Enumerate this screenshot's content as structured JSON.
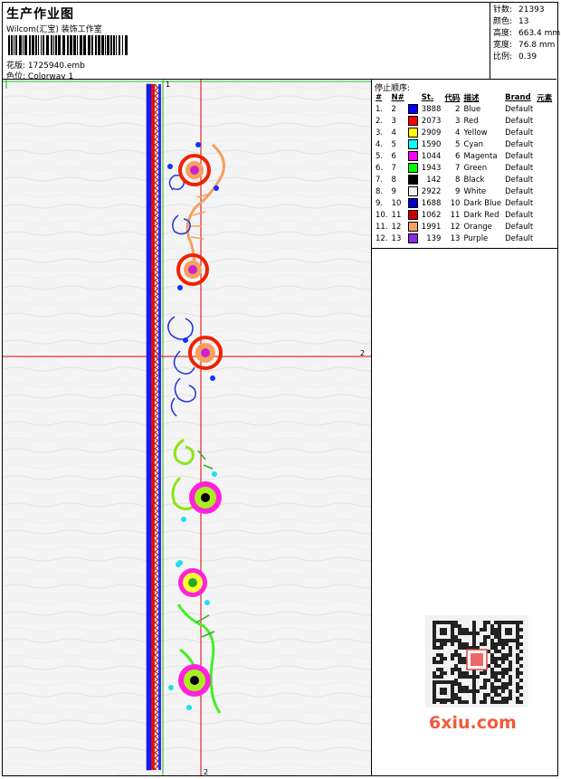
{
  "header": {
    "title": "生产作业图",
    "company": "Wilcom(汇宝) 装饰工作室",
    "design_label": "花版:",
    "design_file": "1725940.emb",
    "colorway_label": "色位:",
    "colorway": "Colorway 1"
  },
  "stats": [
    {
      "label": "针数:",
      "value": "21393"
    },
    {
      "label": "颜色:",
      "value": "13"
    },
    {
      "label": "高度:",
      "value": "663.4 mm"
    },
    {
      "label": "宽度:",
      "value": "76.8 mm"
    },
    {
      "label": "比例:",
      "value": "0.39"
    }
  ],
  "guides": {
    "v1": "1",
    "h2": "2",
    "v2": "2"
  },
  "stop_sequence": {
    "title": "停止顺序:",
    "headers": [
      "#",
      "N#",
      "St.",
      "代码",
      "描述",
      "Brand",
      "元素"
    ],
    "rows": [
      {
        "idx": "1.",
        "n": "2",
        "color": "#0000ff",
        "st": "3888",
        "code": "2",
        "desc": "Blue",
        "brand": "Default"
      },
      {
        "idx": "2.",
        "n": "3",
        "color": "#ff0000",
        "st": "2073",
        "code": "3",
        "desc": "Red",
        "brand": "Default"
      },
      {
        "idx": "3.",
        "n": "4",
        "color": "#ffff00",
        "st": "2909",
        "code": "4",
        "desc": "Yellow",
        "brand": "Default"
      },
      {
        "idx": "4.",
        "n": "5",
        "color": "#00ffff",
        "st": "1590",
        "code": "5",
        "desc": "Cyan",
        "brand": "Default"
      },
      {
        "idx": "5.",
        "n": "6",
        "color": "#ff00ff",
        "st": "1044",
        "code": "6",
        "desc": "Magenta",
        "brand": "Default"
      },
      {
        "idx": "6.",
        "n": "7",
        "color": "#00ff00",
        "st": "1943",
        "code": "7",
        "desc": "Green",
        "brand": "Default"
      },
      {
        "idx": "7.",
        "n": "8",
        "color": "#000000",
        "st": "142",
        "code": "8",
        "desc": "Black",
        "brand": "Default"
      },
      {
        "idx": "8.",
        "n": "9",
        "color": "#f0f0f0",
        "st": "2922",
        "code": "9",
        "desc": "White",
        "brand": "Default"
      },
      {
        "idx": "9.",
        "n": "10",
        "color": "#0000c8",
        "st": "1688",
        "code": "10",
        "desc": "Dark Blue",
        "brand": "Default"
      },
      {
        "idx": "10.",
        "n": "11",
        "color": "#cc0000",
        "st": "1062",
        "code": "11",
        "desc": "Dark Red",
        "brand": "Default"
      },
      {
        "idx": "11.",
        "n": "12",
        "color": "#f7a060",
        "st": "1991",
        "code": "12",
        "desc": "Orange",
        "brand": "Default"
      },
      {
        "idx": "12.",
        "n": "13",
        "color": "#8a2be2",
        "st": "139",
        "code": "13",
        "desc": "Purple",
        "brand": "Default"
      }
    ]
  },
  "watermark": {
    "text": "6xiu.com",
    "color": "#f15a3a"
  }
}
